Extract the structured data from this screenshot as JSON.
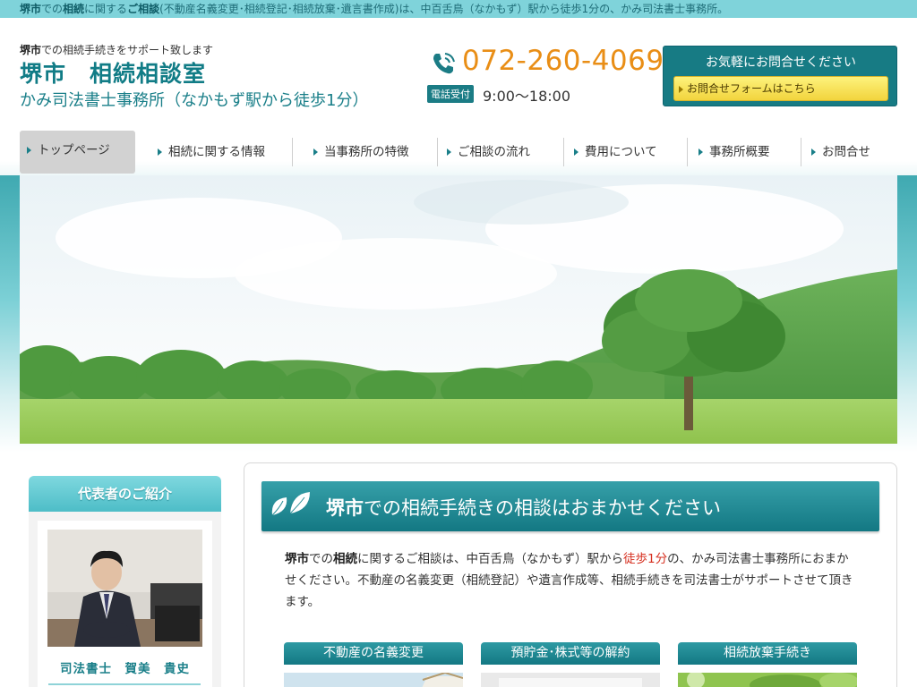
{
  "topbar": {
    "part1": "堺市",
    "part2": "での",
    "part3": "相続",
    "part4": "に関する",
    "part5": "ご相談",
    "part6": "(不動産名義変更･相続登記･相続放棄･遺言書作成)は、中百舌鳥（なかもず）駅から徒歩1分の、かみ司法書士事務所。"
  },
  "header": {
    "tagline_bold": "堺市",
    "tagline_rest": "での相続手続きをサポート致します",
    "title": "堺市　相続相談室",
    "subtitle": "かみ司法書士事務所（なかもず駅から徒歩1分）",
    "phone": "072-260-4069",
    "hours_badge": "電話受付",
    "hours": "9:00〜18:00",
    "contact_title": "お気軽にお問合せください",
    "contact_button": "お問合せフォームはこちら"
  },
  "nav": {
    "items": [
      "トップページ",
      "相続に関する情報",
      "当事務所の特徴",
      "ご相談の流れ",
      "費用について",
      "事務所概要",
      "お問合せ"
    ]
  },
  "sidebar": {
    "heading": "代表者のご紹介",
    "name": "司法書士　賀美　貴史"
  },
  "main": {
    "heading_bold": "堺市",
    "heading_rest": "での相続手続きの相談はおまかせください",
    "intro_1": "堺市",
    "intro_2": "での",
    "intro_3": "相続",
    "intro_4": "に関するご相談は、中百舌鳥（なかもず）駅から",
    "intro_5": "徒歩1分",
    "intro_6": "の、かみ司法書士事務所におまかせください。不動産の名義変更（相続登記）や遺言作成等、相続手続きを司法書士がサポートさせて頂きます。",
    "services": [
      "不動産の名義変更",
      "預貯金･株式等の解約",
      "相続放棄手続き"
    ]
  },
  "colors": {
    "accent": "#177b84",
    "phone": "#e98e16",
    "highlight_red": "#d62e1e",
    "topbar": "#7fd3da"
  },
  "icons": {
    "phone": "phone-icon",
    "leaf": "leaf-icon",
    "nav_arrow": "triangle-right-icon"
  }
}
